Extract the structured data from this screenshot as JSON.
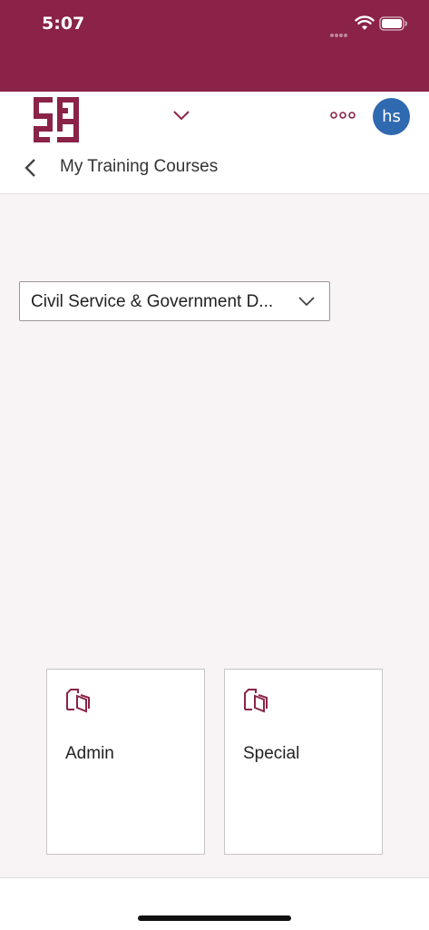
{
  "status_bar": {
    "time": "5:07"
  },
  "header": {
    "avatar_initials": "hs",
    "page_title": "My Training Courses"
  },
  "filter": {
    "selected": "Civil Service & Government D..."
  },
  "cards": [
    {
      "label": "Admin",
      "icon": "document-copy-icon"
    },
    {
      "label": "Special",
      "icon": "document-copy-icon"
    }
  ],
  "colors": {
    "brand": "#8a2347",
    "avatar": "#2f69b0",
    "content_background": "#f8f4f5"
  }
}
